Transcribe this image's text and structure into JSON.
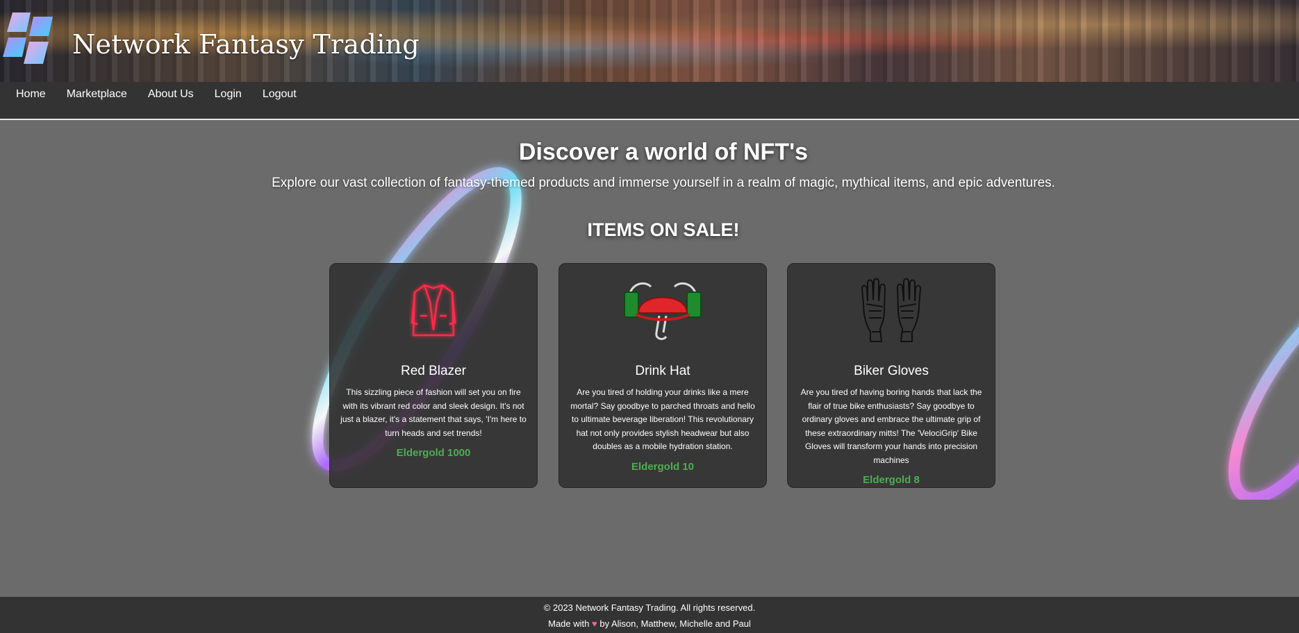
{
  "header": {
    "site_title": "Network Fantasy Trading"
  },
  "nav": {
    "items": [
      "Home",
      "Marketplace",
      "About Us",
      "Login",
      "Logout"
    ]
  },
  "hero": {
    "title": "Discover a world of NFT's",
    "subtitle": "Explore our vast collection of fantasy-themed products and immerse yourself in a realm of magic, mythical items, and epic adventures."
  },
  "sale": {
    "title": "ITEMS ON SALE!"
  },
  "products": [
    {
      "name": "Red Blazer",
      "description": "This sizzling piece of fashion will set you on fire with its vibrant red color and sleek design. It's not just a blazer, it's a statement that says, 'I'm here to turn heads and set trends!",
      "price": "Eldergold 1000",
      "icon": "blazer-icon"
    },
    {
      "name": "Drink Hat",
      "description": "Are you tired of holding your drinks like a mere mortal? Say goodbye to parched throats and hello to ultimate beverage liberation! This revolutionary hat not only provides stylish headwear but also doubles as a mobile hydration station.",
      "price": "Eldergold 10",
      "icon": "drink-hat-icon"
    },
    {
      "name": "Biker Gloves",
      "description": "Are you tired of having boring hands that lack the flair of true bike enthusiasts? Say goodbye to ordinary gloves and embrace the ultimate grip of these extraordinary mitts! The 'VelociGrip' Bike Gloves will transform your hands into precision machines",
      "price": "Eldergold 8",
      "icon": "gloves-icon"
    }
  ],
  "footer": {
    "copyright": "© 2023 Network Fantasy Trading. All rights reserved.",
    "made_with": "Made with",
    "heart": "♥",
    "authors": "by Alison, Matthew, Michelle and Paul"
  },
  "colors": {
    "page_bg": "#6b6b6b",
    "nav_bg": "#333333",
    "card_bg": "#2f2f2f",
    "price": "#4caf50",
    "heart": "#ff5fa2"
  }
}
